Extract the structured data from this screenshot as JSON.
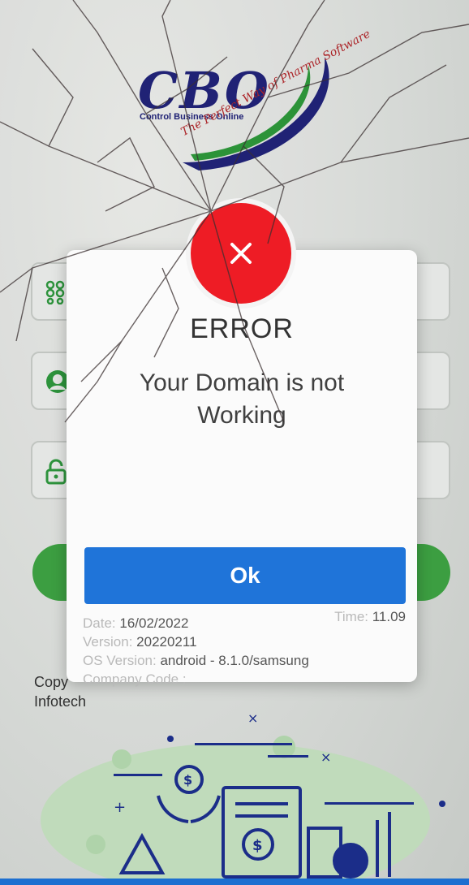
{
  "logo": {
    "text": "CBO",
    "subtitle": "Control Business Online",
    "tagline": "The Perfect Way of Pharma Software"
  },
  "copyright": {
    "line1": "Copy",
    "line2": "Infotech"
  },
  "dialog": {
    "title": "ERROR",
    "message": "Your Domain is not Working",
    "ok_label": "Ok",
    "date_label": "Date: ",
    "date_value": "16/02/2022",
    "version_label": "Version: ",
    "version_value": "20220211",
    "os_label": "OS Version: ",
    "os_value": "android - 8.1.0/samsung",
    "company_label": "Company Code :",
    "company_value": "",
    "time_label": "Time: ",
    "time_value": "11.09"
  },
  "icons": {
    "error": "close-icon",
    "field1": "grid-icon",
    "field2": "user-icon",
    "field3": "lock-icon"
  },
  "colors": {
    "error_red": "#ee1c25",
    "ok_blue": "#1f74d9",
    "accent_green": "#3fa544",
    "brand_navy": "#22247a",
    "brand_red": "#b3262a"
  }
}
